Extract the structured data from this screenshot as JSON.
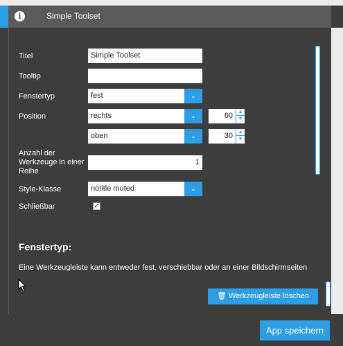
{
  "header": {
    "title": "Simple Toolset",
    "icon": "info-icon"
  },
  "form": {
    "title_label": "Titel",
    "title_value": "Simple Toolset",
    "tooltip_label": "Tooltip",
    "tooltip_value": "",
    "window_type_label": "Fenstertyp",
    "window_type_value": "fest",
    "position_label": "Position",
    "position_h_value": "rechts",
    "position_h_offset": "60",
    "position_v_value": "oben",
    "position_v_offset": "30",
    "tools_per_row_label": "Anzahl der Werkzeuge in einer Reihe",
    "tools_per_row_value": "1",
    "style_class_label": "Style-Klasse",
    "style_class_value": "notitle muted",
    "closable_label": "Schließbar",
    "closable_checked": true
  },
  "help": {
    "title": "Fenstertyp:",
    "text": "Eine Werkzeugleiste kann entweder fest, verschiebbar oder an einer Bildschirmseiten"
  },
  "buttons": {
    "delete_label": "Werkzeugleiste löschen",
    "save_label": "App speichern"
  },
  "colors": {
    "accent": "#2e9de4",
    "panel": "#3d3d3e",
    "header": "#5a5a5b"
  }
}
